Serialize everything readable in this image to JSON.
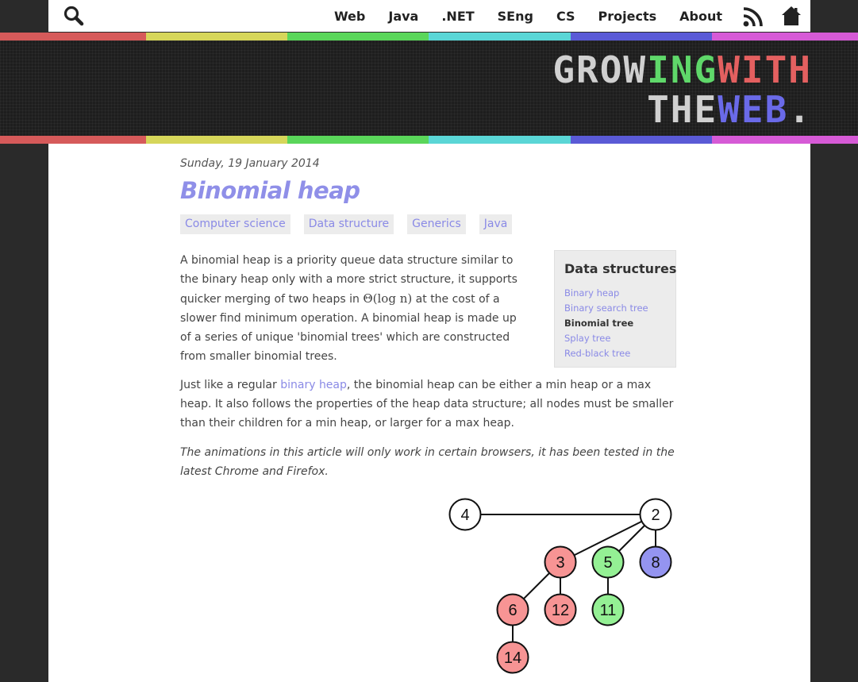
{
  "nav": {
    "links": [
      "Web",
      "Java",
      ".NET",
      "SEng",
      "CS",
      "Projects",
      "About"
    ],
    "search_icon": "search-icon",
    "rss_icon": "rss-icon",
    "home_icon": "home-icon"
  },
  "rainbow_colors": [
    "#d65a5a",
    "#d6d65a",
    "#5ad65a",
    "#5ad6d6",
    "#5a5ad6",
    "#d65ad6"
  ],
  "logo": {
    "line1_part1": "GROW",
    "line1_part2": "ING",
    "line1_part3": "WITH",
    "line2_part1": "THE",
    "line2_part2": "WEB",
    "line2_part3": "."
  },
  "post": {
    "date": "Sunday, 19 January 2014",
    "title": "Binomial heap",
    "tags": [
      "Computer science",
      "Data structure",
      "Generics",
      "Java"
    ],
    "para1_before_math": "A binomial heap is a priority queue data structure similar to the binary heap only with a more strict structure, it supports quicker merging of two heaps in ",
    "para1_math": "Θ(log n)",
    "para1_after_math": " at the cost of a slower find minimum operation. A binomial heap is made up of a series of unique 'binomial trees' which are constructed from smaller binomial trees.",
    "para2_before_link": "Just like a regular ",
    "para2_link": "binary heap",
    "para2_after_link": ", the binomial heap can be either a min heap or a max heap. It also follows the properties of the heap data structure; all nodes must be smaller than their children for a min heap, or larger for a max heap.",
    "para3": "The animations in this article will only work in certain browsers, it has been tested in the latest Chrome and Firefox."
  },
  "sidebar": {
    "title": "Data structures",
    "items": [
      {
        "label": "Binary heap",
        "current": false
      },
      {
        "label": "Binary search tree",
        "current": false
      },
      {
        "label": "Binomial tree",
        "current": true
      },
      {
        "label": "Splay tree",
        "current": false
      },
      {
        "label": "Red-black tree",
        "current": false
      }
    ]
  },
  "heap_diagram": {
    "node_colors": {
      "root": "#ffffff",
      "red": "#f79494",
      "green": "#94f094",
      "blue": "#9494f0"
    },
    "nodes": [
      {
        "id": "n4",
        "value": "4",
        "color": "root"
      },
      {
        "id": "n2",
        "value": "2",
        "color": "root"
      },
      {
        "id": "n3",
        "value": "3",
        "color": "red"
      },
      {
        "id": "n5",
        "value": "5",
        "color": "green"
      },
      {
        "id": "n8",
        "value": "8",
        "color": "blue"
      },
      {
        "id": "n6",
        "value": "6",
        "color": "red"
      },
      {
        "id": "n12",
        "value": "12",
        "color": "red"
      },
      {
        "id": "n11",
        "value": "11",
        "color": "green"
      },
      {
        "id": "n14",
        "value": "14",
        "color": "red"
      }
    ],
    "edges": [
      [
        "n4",
        "n2"
      ],
      [
        "n2",
        "n3"
      ],
      [
        "n2",
        "n5"
      ],
      [
        "n2",
        "n8"
      ],
      [
        "n3",
        "n6"
      ],
      [
        "n3",
        "n12"
      ],
      [
        "n5",
        "n11"
      ],
      [
        "n6",
        "n14"
      ]
    ]
  }
}
